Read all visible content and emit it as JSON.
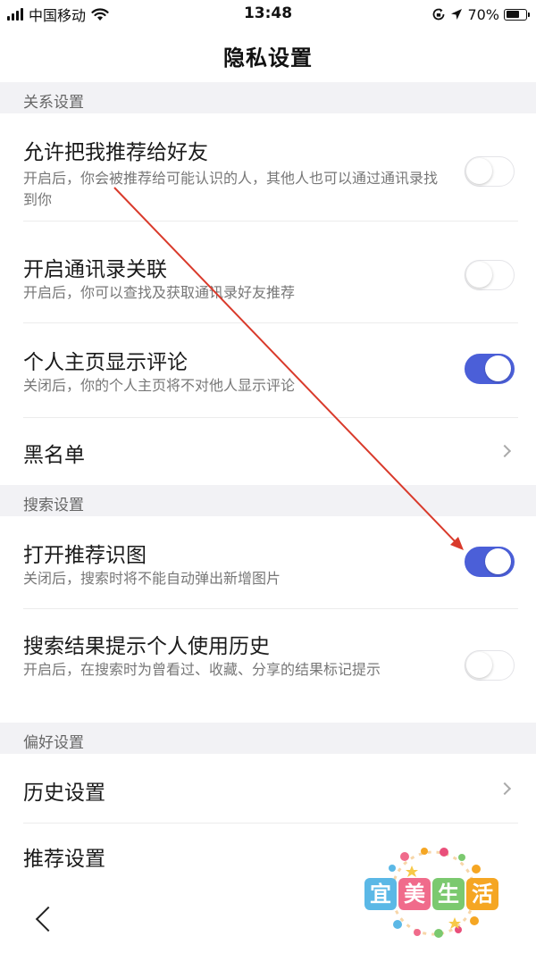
{
  "status_bar": {
    "carrier": "中国移动",
    "time": "13:48",
    "battery": "70%",
    "battery_level": 0.7,
    "icons": [
      "signal-icon",
      "wifi-icon",
      "rotation-lock-icon",
      "location-icon",
      "battery-icon"
    ]
  },
  "nav": {
    "title": "隐私设置"
  },
  "sections": {
    "relation": "关系设置",
    "search": "搜索设置",
    "preference": "偏好设置"
  },
  "rows": {
    "recommend_friend": {
      "title": "允许把我推荐给好友",
      "desc": "开启后，你会被推荐给可能认识的人，其他人也可以通过通讯录找到你",
      "on": false
    },
    "contacts_link": {
      "title": "开启通讯录关联",
      "desc": "开启后，你可以查找及获取通讯录好友推荐",
      "on": false
    },
    "profile_comments": {
      "title": "个人主页显示评论",
      "desc": "关闭后，你的个人主页将不对他人显示评论",
      "on": true
    },
    "blacklist": {
      "title": "黑名单"
    },
    "recommend_image": {
      "title": "打开推荐识图",
      "desc": "关闭后，搜索时将不能自动弹出新增图片",
      "on": true
    },
    "search_history": {
      "title": "搜索结果提示个人使用历史",
      "desc": "开启后，在搜索时为曾看过、收藏、分享的结果标记提示",
      "on": false
    },
    "history_settings": {
      "title": "历史设置"
    },
    "recommend_settings": {
      "title": "推荐设置"
    }
  },
  "colors": {
    "toggle_on": "#4b5fd8",
    "section_bg": "#f2f2f5",
    "annotation_arrow": "#d93a2b"
  },
  "watermark": {
    "text": [
      "宜",
      "美",
      "生",
      "活"
    ]
  }
}
